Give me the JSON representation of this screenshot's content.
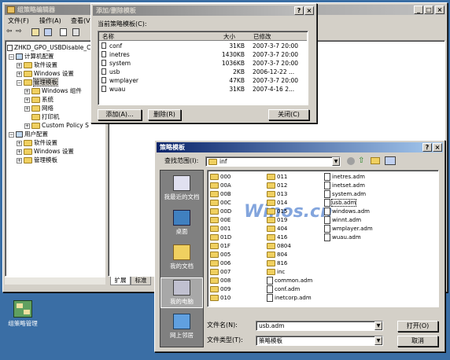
{
  "main_window": {
    "title": "组策略编辑器",
    "menu": [
      "文件(F)",
      "操作(A)",
      "查看(V)"
    ],
    "tree": [
      {
        "label": "ZHKD_GPO_USBDisable_Comp",
        "level": 0
      },
      {
        "label": "计算机配置",
        "level": 1
      },
      {
        "label": "软件设置",
        "level": 2
      },
      {
        "label": "Windows 设置",
        "level": 2
      },
      {
        "label": "管理模板",
        "level": 2,
        "selected": true
      },
      {
        "label": "Windows 组件",
        "level": 3
      },
      {
        "label": "系统",
        "level": 3
      },
      {
        "label": "网络",
        "level": 3
      },
      {
        "label": "打印机",
        "level": 3
      },
      {
        "label": "Custom Policy S",
        "level": 3
      },
      {
        "label": "用户配置",
        "level": 1
      },
      {
        "label": "软件设置",
        "level": 2
      },
      {
        "label": "Windows 设置",
        "level": 2
      },
      {
        "label": "管理模板",
        "level": 2
      }
    ],
    "tabs": [
      "扩展",
      "标准"
    ]
  },
  "desktop_icon": {
    "label": "组策略管理"
  },
  "add_remove_dialog": {
    "title": "添加/删除模板",
    "current_label": "当前策略模板(C):",
    "columns": [
      "名称",
      "大小",
      "已修改"
    ],
    "rows": [
      {
        "name": "conf",
        "size": "31KB",
        "modified": "2007-3-7 20:00"
      },
      {
        "name": "inetres",
        "size": "1430KB",
        "modified": "2007-3-7 20:00"
      },
      {
        "name": "system",
        "size": "1036KB",
        "modified": "2007-3-7 20:00"
      },
      {
        "name": "usb",
        "size": "2KB",
        "modified": "2006-12-22 ..."
      },
      {
        "name": "wmplayer",
        "size": "47KB",
        "modified": "2007-3-7 20:00"
      },
      {
        "name": "wuau",
        "size": "31KB",
        "modified": "2007-4-16 2..."
      }
    ],
    "add_button": "添加(A)...",
    "remove_button": "删除(R)",
    "close_button": "关闭(C)"
  },
  "template_dialog": {
    "title": "策略模板",
    "lookin_label": "查找范围(I):",
    "lookin_value": "inf",
    "watermark": "Winos.cn",
    "places": [
      "我最近的文档",
      "桌面",
      "我的文档",
      "我的电脑",
      "网上邻居"
    ],
    "folders_col1": [
      "000",
      "00A",
      "00B",
      "00C",
      "00D",
      "00E",
      "001",
      "01D",
      "01F",
      "005",
      "006",
      "007",
      "008",
      "009",
      "010"
    ],
    "folders_col2": [
      "011",
      "012",
      "013",
      "014",
      "015",
      "019",
      "404",
      "416",
      "0804",
      "804",
      "816",
      "inc"
    ],
    "files_col2": [
      "common.adm",
      "conf.adm",
      "inetcorp.adm"
    ],
    "files_col3": [
      "inetres.adm",
      "inetset.adm",
      "system.adm",
      "usb.adm",
      "windows.adm",
      "winnt.adm",
      "wmplayer.adm",
      "wuau.adm"
    ],
    "filename_label": "文件名(N):",
    "filename_value": "usb.adm",
    "filetype_label": "文件类型(T):",
    "filetype_value": "策略模板",
    "open_button": "打开(O)",
    "cancel_button": "取消"
  },
  "colors": {
    "desktop": "#3a6ea5",
    "title_active": "#0a246a",
    "face": "#d4d0c8"
  }
}
